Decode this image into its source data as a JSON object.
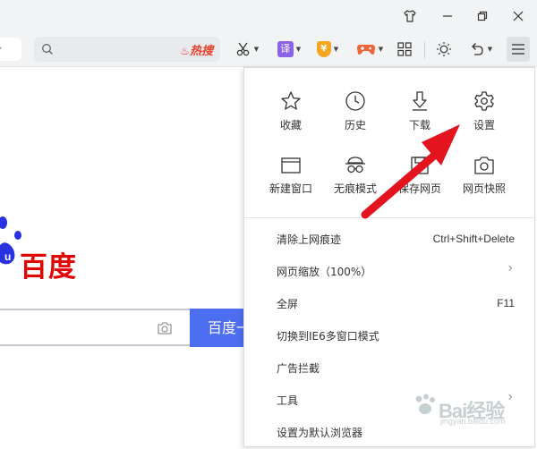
{
  "toolbar": {
    "search_placeholder": "",
    "hot_label": "热搜",
    "translate_label": "译",
    "coupon_label": "¥"
  },
  "page": {
    "baidu_text": "百度",
    "search_button": "百度一下"
  },
  "menu": {
    "grid": [
      {
        "label": "收藏",
        "icon": "star-icon"
      },
      {
        "label": "历史",
        "icon": "clock-icon"
      },
      {
        "label": "下载",
        "icon": "download-icon"
      },
      {
        "label": "设置",
        "icon": "gear-icon"
      },
      {
        "label": "新建窗口",
        "icon": "new-window-icon"
      },
      {
        "label": "无痕模式",
        "icon": "incognito-icon"
      },
      {
        "label": "保存网页",
        "icon": "save-page-icon"
      },
      {
        "label": "网页快照",
        "icon": "camera-icon"
      }
    ],
    "items": [
      {
        "label": "清除上网痕迹",
        "shortcut": "Ctrl+Shift+Delete"
      },
      {
        "label": "网页缩放（100%）",
        "submenu": true
      },
      {
        "label": "全屏",
        "shortcut": "F11"
      },
      {
        "label": "切换到IE6多窗口模式"
      },
      {
        "label": "广告拦截"
      },
      {
        "label": "工具",
        "submenu": true
      },
      {
        "label": "设置为默认浏览器"
      }
    ]
  },
  "watermark": {
    "brand": "Bai经验",
    "url": "jingyan.baidu.com"
  },
  "colors": {
    "arrow": "#e3141e",
    "baidu_red": "#e10602",
    "baidu_blue": "#2932e1",
    "search_button": "#4e6ef2",
    "hot": "#e8412c"
  }
}
